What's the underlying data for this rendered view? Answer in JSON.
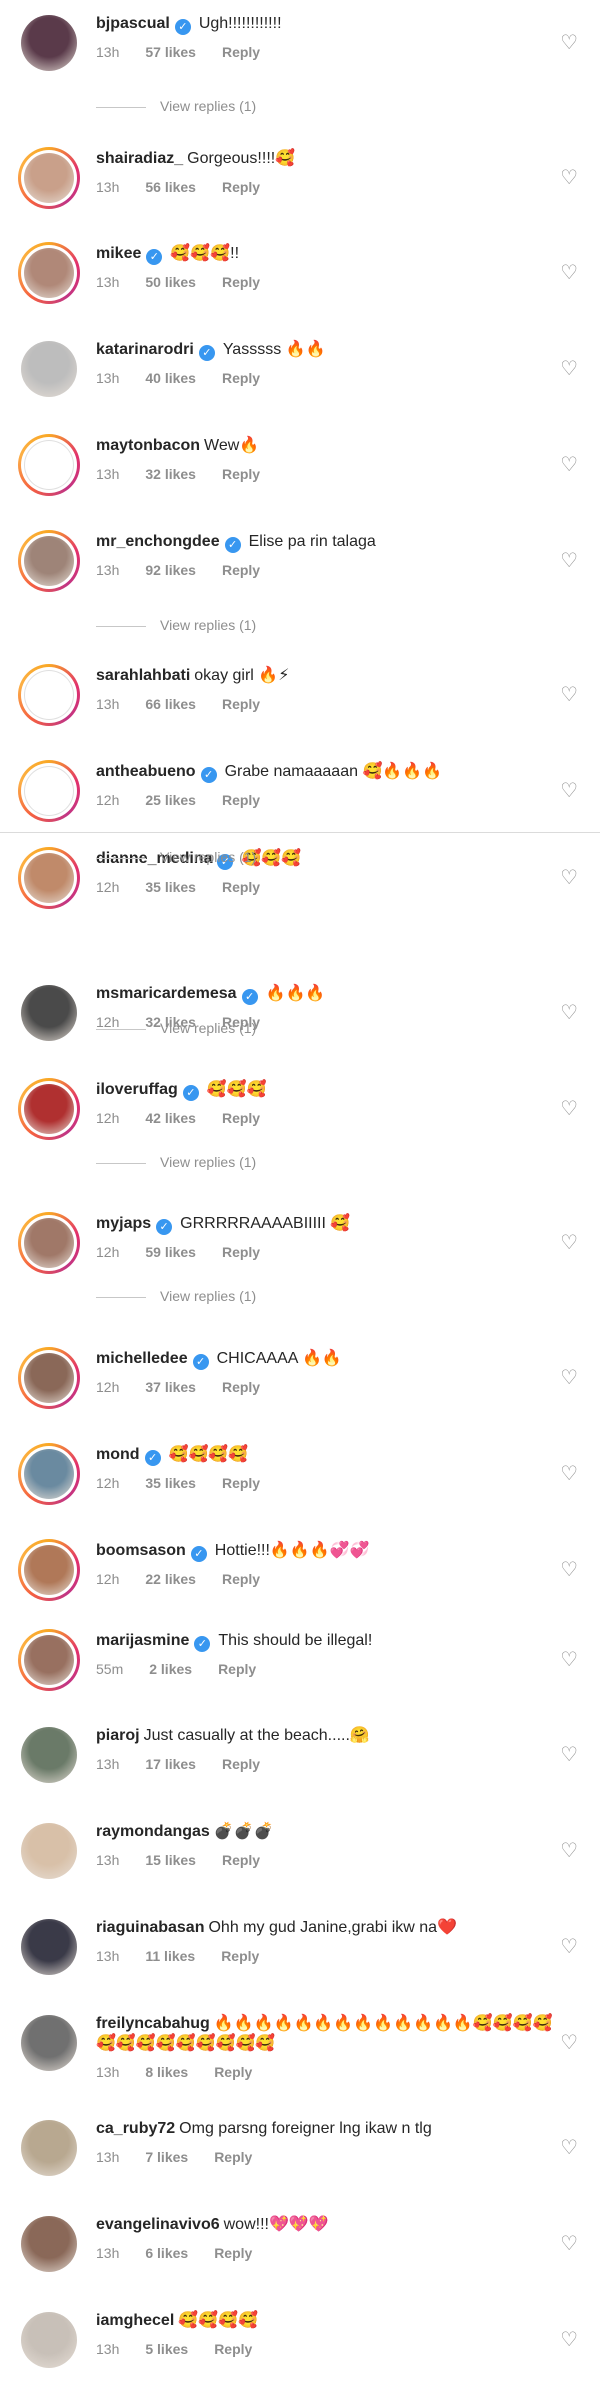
{
  "comments": [
    {
      "username": "bjpascual",
      "verified": true,
      "text": "Ugh!!!!!!!!!!!!",
      "time": "13h",
      "likes": "57 likes",
      "reply": "Reply",
      "ring": false,
      "avatar_color": "#5a3a4a"
    },
    {
      "username": "shairadiaz_",
      "verified": false,
      "text": "Gorgeous!!!!🥰",
      "time": "13h",
      "likes": "56 likes",
      "reply": "Reply",
      "ring": true,
      "avatar_color": "#c9a08a"
    },
    {
      "username": "mikee",
      "verified": true,
      "text": "🥰🥰🥰!!",
      "time": "13h",
      "likes": "50 likes",
      "reply": "Reply",
      "ring": true,
      "avatar_color": "#b08878"
    },
    {
      "username": "katarinarodri",
      "verified": true,
      "text": "Yasssss 🔥🔥",
      "time": "13h",
      "likes": "40 likes",
      "reply": "Reply",
      "ring": false,
      "avatar_color": "#bdbdbd"
    },
    {
      "username": "maytonbacon",
      "verified": false,
      "text": "Wew🔥",
      "time": "13h",
      "likes": "32 likes",
      "reply": "Reply",
      "ring": true,
      "avatar_color": "#ffffff"
    },
    {
      "username": "mr_enchongdee",
      "verified": true,
      "text": "Elise pa rin talaga",
      "time": "13h",
      "likes": "92 likes",
      "reply": "Reply",
      "ring": true,
      "avatar_color": "#9e8478"
    },
    {
      "username": "sarahlahbati",
      "verified": false,
      "text": "okay girl 🔥⚡",
      "time": "13h",
      "likes": "66 likes",
      "reply": "Reply",
      "ring": true,
      "avatar_color": "#ffffff"
    },
    {
      "username": "antheabueno",
      "verified": true,
      "text": "Grabe namaaaaan 🥰🔥🔥🔥",
      "time": "12h",
      "likes": "25 likes",
      "reply": "Reply",
      "ring": true,
      "avatar_color": "#ffffff"
    },
    {
      "username": "dianne_medina",
      "verified": true,
      "text": "🥰🥰🥰",
      "time": "12h",
      "likes": "35 likes",
      "reply": "Reply",
      "ring": true,
      "avatar_color": "#c08a6a"
    },
    {
      "username": "msmaricardemesa",
      "verified": true,
      "text": "🔥🔥🔥",
      "time": "12h",
      "likes": "32 likes",
      "reply": "Reply",
      "ring": false,
      "avatar_color": "#4a4a4a"
    },
    {
      "username": "iloveruffag",
      "verified": true,
      "text": "🥰🥰🥰",
      "time": "12h",
      "likes": "42 likes",
      "reply": "Reply",
      "ring": true,
      "avatar_color": "#b03030"
    },
    {
      "username": "myjaps",
      "verified": true,
      "text": "GRRRRRAAAABIIIII 🥰",
      "time": "12h",
      "likes": "59 likes",
      "reply": "Reply",
      "ring": true,
      "avatar_color": "#a07868"
    },
    {
      "username": "michelledee",
      "verified": true,
      "text": "CHICAAAA 🔥🔥",
      "time": "12h",
      "likes": "37 likes",
      "reply": "Reply",
      "ring": true,
      "avatar_color": "#8a6858"
    },
    {
      "username": "mond",
      "verified": true,
      "text": "🥰🥰🥰🥰",
      "time": "12h",
      "likes": "35 likes",
      "reply": "Reply",
      "ring": true,
      "avatar_color": "#6a8aa0"
    },
    {
      "username": "boomsason",
      "verified": true,
      "text": "Hottie!!!🔥🔥🔥💞💞",
      "time": "12h",
      "likes": "22 likes",
      "reply": "Reply",
      "ring": true,
      "avatar_color": "#b07858"
    },
    {
      "username": "marijasmine",
      "verified": true,
      "text": "This should be illegal!",
      "time": "55m",
      "likes": "2 likes",
      "reply": "Reply",
      "ring": true,
      "avatar_color": "#987060"
    },
    {
      "username": "piaroj",
      "verified": false,
      "text": "Just casually at the beach.....🤗",
      "time": "13h",
      "likes": "17 likes",
      "reply": "Reply",
      "ring": false,
      "avatar_color": "#6a7a68"
    },
    {
      "username": "raymondangas",
      "verified": false,
      "text": "💣💣💣",
      "time": "13h",
      "likes": "15 likes",
      "reply": "Reply",
      "ring": false,
      "avatar_color": "#d8c0a8"
    },
    {
      "username": "riaguinabasan",
      "verified": false,
      "text": "Ohh my gud Janine,grabi ikw na❤️",
      "time": "13h",
      "likes": "11 likes",
      "reply": "Reply",
      "ring": false,
      "avatar_color": "#3a3a48"
    },
    {
      "username": "freilyncabahug",
      "verified": false,
      "text": "🔥🔥🔥🔥🔥🔥🔥🔥🔥🔥🔥🔥🔥🥰🥰🥰🥰",
      "text2": "🥰🥰🥰🥰🥰🥰🥰🥰🥰",
      "time": "13h",
      "likes": "8 likes",
      "reply": "Reply",
      "ring": false,
      "avatar_color": "#707070"
    },
    {
      "username": "ca_ruby72",
      "verified": false,
      "text": "Omg parsng foreigner lng ikaw n tlg",
      "time": "13h",
      "likes": "7 likes",
      "reply": "Reply",
      "ring": false,
      "avatar_color": "#b8a890"
    },
    {
      "username": "evangelinavivo6",
      "verified": false,
      "text": "wow!!!💖💖💖",
      "time": "13h",
      "likes": "6 likes",
      "reply": "Reply",
      "ring": false,
      "avatar_color": "#8a6858"
    },
    {
      "username": "iamghecel",
      "verified": false,
      "text": "🥰🥰🥰🥰",
      "time": "13h",
      "likes": "5 likes",
      "reply": "Reply",
      "ring": false,
      "avatar_color": "#c8c0b8"
    }
  ],
  "view_replies_label": "View replies (1)"
}
